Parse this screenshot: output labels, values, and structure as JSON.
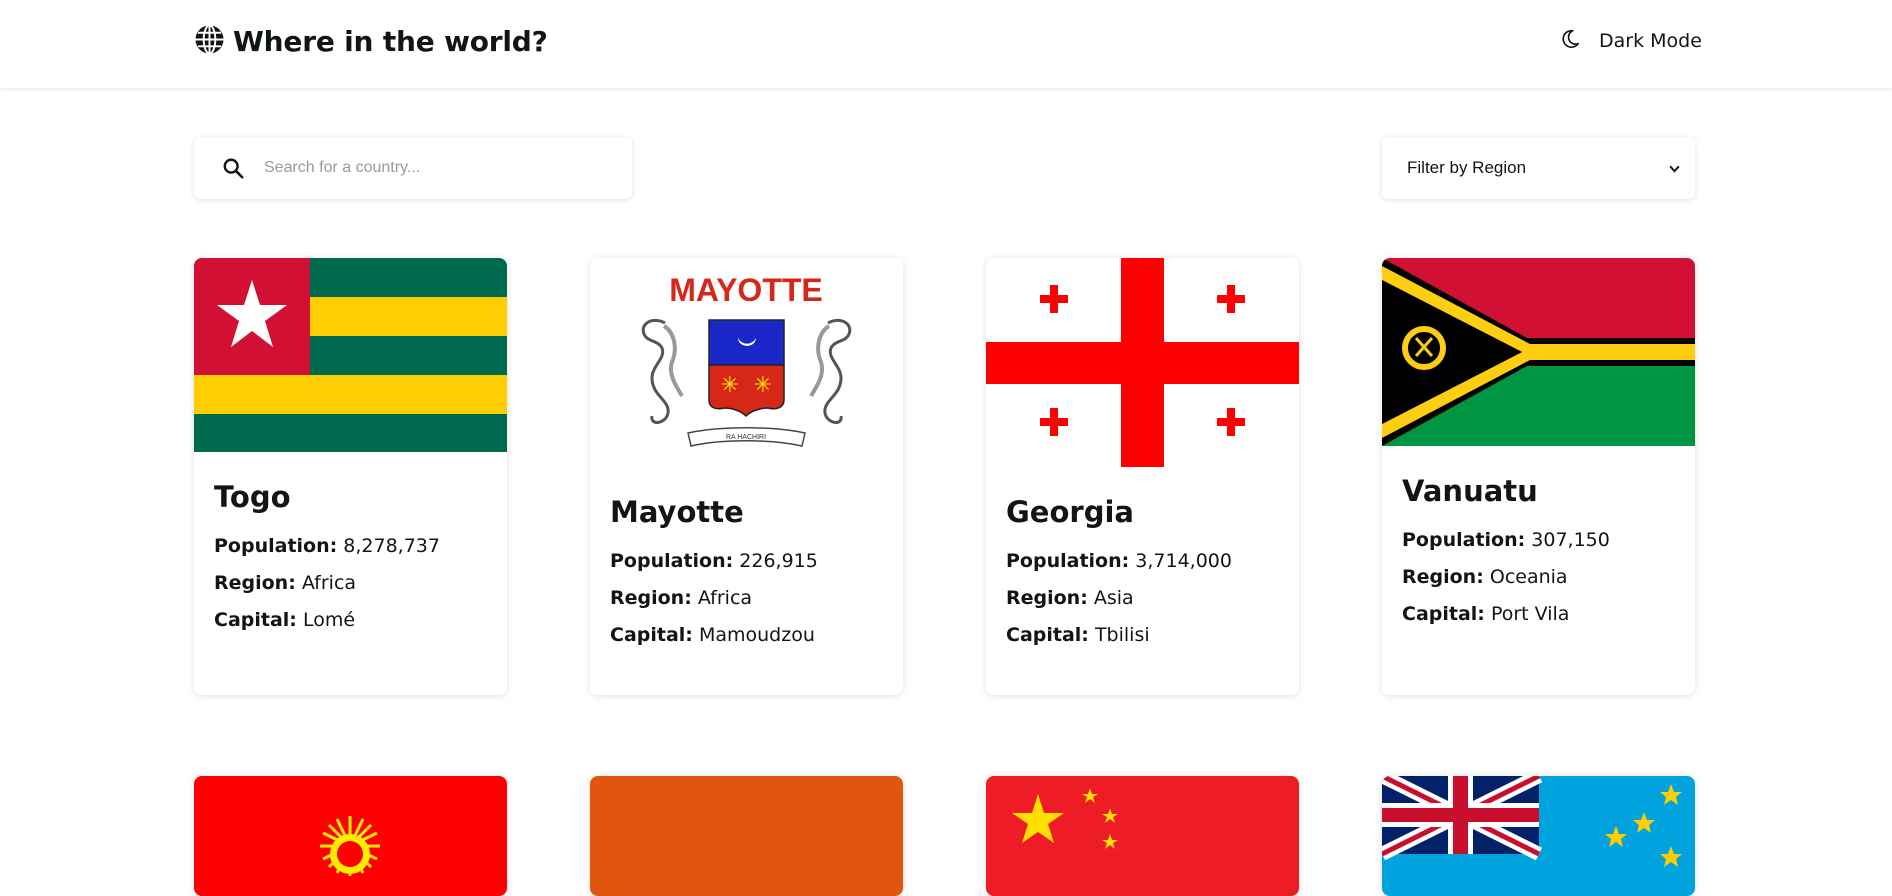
{
  "header": {
    "title": "Where in the world?",
    "theme_toggle_label": "Dark Mode",
    "brand_icon": "globe-icon",
    "theme_icon": "moon-icon"
  },
  "search": {
    "placeholder": "Search for a country...",
    "value": "",
    "icon": "search-icon"
  },
  "filter": {
    "selected_label": "Filter by Region",
    "icon": "chevron-down-icon"
  },
  "labels": {
    "population": "Population:",
    "region": "Region:",
    "capital": "Capital:"
  },
  "countries": [
    {
      "name": "Togo",
      "population": "8,278,737",
      "region": "Africa",
      "capital": "Lomé",
      "flag": "togo-flag"
    },
    {
      "name": "Mayotte",
      "population": "226,915",
      "region": "Africa",
      "capital": "Mamoudzou",
      "flag": "mayotte-flag",
      "flag_text": "MAYOTTE",
      "motto": "RA HACHIRI"
    },
    {
      "name": "Georgia",
      "population": "3,714,000",
      "region": "Asia",
      "capital": "Tbilisi",
      "flag": "georgia-flag"
    },
    {
      "name": "Vanuatu",
      "population": "307,150",
      "region": "Oceania",
      "capital": "Port Vila",
      "flag": "vanuatu-flag"
    }
  ],
  "partial_cards": [
    "kyrgyzstan-flag",
    "orange-flag",
    "china-flag",
    "tuvalu-flag"
  ],
  "colors": {
    "text": "#111517",
    "background": "#ffffff",
    "togo_green": "#006a4e",
    "togo_yellow": "#ffce00",
    "togo_red": "#d21034",
    "georgia_red": "#ff0000",
    "vanuatu_red": "#d21034",
    "vanuatu_green": "#009543",
    "vanuatu_yellow": "#fdce12"
  }
}
